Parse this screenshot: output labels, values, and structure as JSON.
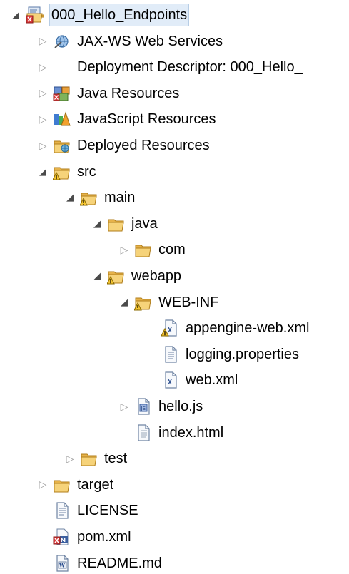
{
  "tree": [
    {
      "label": "000_Hello_Endpoints",
      "icon": "project-icon",
      "state": "open",
      "depth": 0,
      "selected": true
    },
    {
      "label": "JAX-WS Web Services",
      "icon": "webservice-icon",
      "state": "closed",
      "depth": 1
    },
    {
      "label": "Deployment Descriptor: 000_Hello_",
      "icon": "",
      "state": "closed",
      "depth": 1
    },
    {
      "label": "Java Resources",
      "icon": "java-resources-icon",
      "state": "closed",
      "depth": 1
    },
    {
      "label": "JavaScript Resources",
      "icon": "javascript-resources-icon",
      "state": "closed",
      "depth": 1
    },
    {
      "label": "Deployed Resources",
      "icon": "deployed-resources-icon",
      "state": "closed",
      "depth": 1
    },
    {
      "label": "src",
      "icon": "folder-warning-icon",
      "state": "open",
      "depth": 1
    },
    {
      "label": "main",
      "icon": "folder-warning-icon",
      "state": "open",
      "depth": 2
    },
    {
      "label": "java",
      "icon": "folder-icon",
      "state": "open",
      "depth": 3
    },
    {
      "label": "com",
      "icon": "folder-icon",
      "state": "closed",
      "depth": 4
    },
    {
      "label": "webapp",
      "icon": "folder-warning-icon",
      "state": "open",
      "depth": 3
    },
    {
      "label": "WEB-INF",
      "icon": "folder-warning-icon",
      "state": "open",
      "depth": 4
    },
    {
      "label": "appengine-web.xml",
      "icon": "xml-warning-icon",
      "state": "leaf",
      "depth": 5
    },
    {
      "label": "logging.properties",
      "icon": "text-file-icon",
      "state": "leaf",
      "depth": 5
    },
    {
      "label": "web.xml",
      "icon": "xml-file-icon",
      "state": "leaf",
      "depth": 5
    },
    {
      "label": "hello.js",
      "icon": "js-file-icon",
      "state": "closed",
      "depth": 4
    },
    {
      "label": "index.html",
      "icon": "html-file-icon",
      "state": "leaf",
      "depth": 4
    },
    {
      "label": "test",
      "icon": "folder-icon",
      "state": "closed",
      "depth": 2
    },
    {
      "label": "target",
      "icon": "folder-icon",
      "state": "closed",
      "depth": 1
    },
    {
      "label": "LICENSE",
      "icon": "text-file-icon",
      "state": "leaf",
      "depth": 1
    },
    {
      "label": "pom.xml",
      "icon": "maven-pom-icon",
      "state": "leaf",
      "depth": 1
    },
    {
      "label": "README.md",
      "icon": "markdown-file-icon",
      "state": "leaf",
      "depth": 1
    }
  ]
}
